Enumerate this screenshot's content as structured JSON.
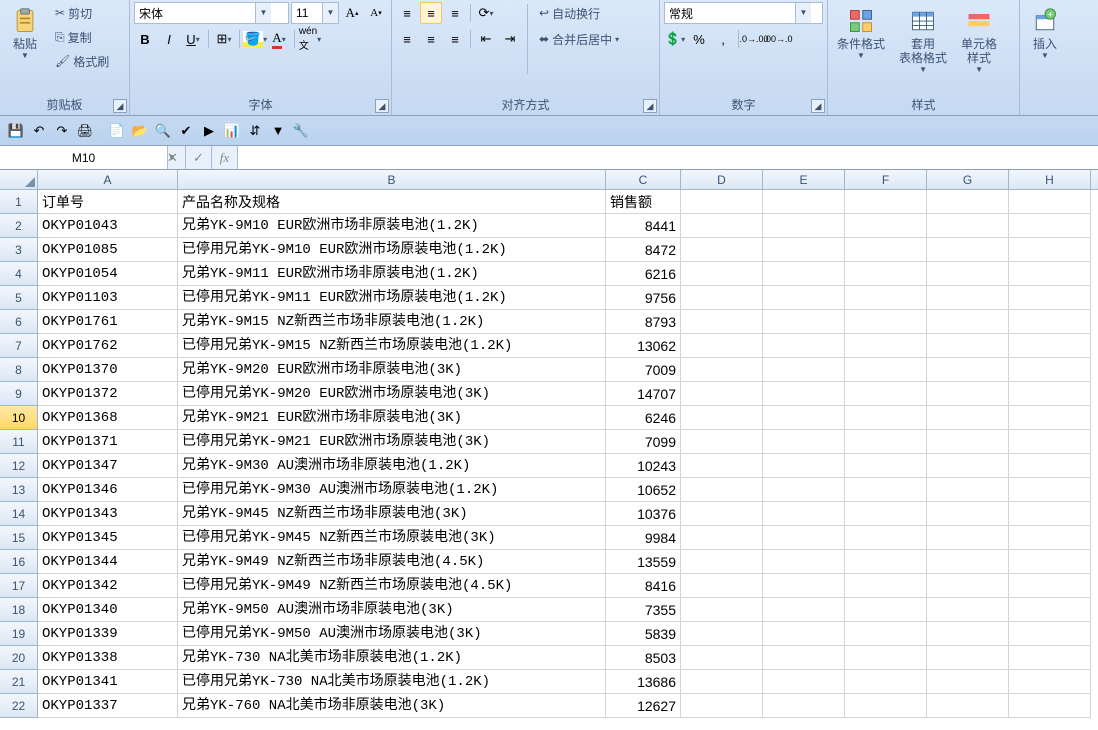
{
  "ribbon": {
    "clipboard": {
      "paste": "粘贴",
      "cut": "剪切",
      "copy": "复制",
      "format_painter": "格式刷",
      "label": "剪贴板"
    },
    "font": {
      "name": "宋体",
      "size": "11",
      "label": "字体"
    },
    "alignment": {
      "wrap": "自动换行",
      "merge": "合并后居中",
      "label": "对齐方式"
    },
    "number": {
      "format": "常规",
      "label": "数字"
    },
    "styles": {
      "conditional": "条件格式",
      "table": "套用\n表格格式",
      "cell": "单元格\n样式",
      "label": "样式"
    },
    "cells": {
      "insert": "插入"
    }
  },
  "namebox": "M10",
  "columns": [
    "A",
    "B",
    "C",
    "D",
    "E",
    "F",
    "G",
    "H"
  ],
  "header_row": {
    "A": "订单号",
    "B": "产品名称及规格",
    "C": "销售额"
  },
  "rows": [
    {
      "n": 1,
      "A": "订单号",
      "B": "产品名称及规格",
      "C": "销售额",
      "header": true
    },
    {
      "n": 2,
      "A": "OKYP01043",
      "B": "兄弟YK-9M10 EUR欧洲市场非原装电池(1.2K)",
      "C": "8441"
    },
    {
      "n": 3,
      "A": "OKYP01085",
      "B": "已停用兄弟YK-9M10 EUR欧洲市场原装电池(1.2K)",
      "C": "8472"
    },
    {
      "n": 4,
      "A": "OKYP01054",
      "B": "兄弟YK-9M11 EUR欧洲市场非原装电池(1.2K)",
      "C": "6216"
    },
    {
      "n": 5,
      "A": "OKYP01103",
      "B": "已停用兄弟YK-9M11 EUR欧洲市场原装电池(1.2K)",
      "C": "9756"
    },
    {
      "n": 6,
      "A": "OKYP01761",
      "B": "兄弟YK-9M15 NZ新西兰市场非原装电池(1.2K)",
      "C": "8793"
    },
    {
      "n": 7,
      "A": "OKYP01762",
      "B": "已停用兄弟YK-9M15 NZ新西兰市场原装电池(1.2K)",
      "C": "13062"
    },
    {
      "n": 8,
      "A": "OKYP01370",
      "B": "兄弟YK-9M20 EUR欧洲市场非原装电池(3K)",
      "C": "7009"
    },
    {
      "n": 9,
      "A": "OKYP01372",
      "B": "已停用兄弟YK-9M20 EUR欧洲市场原装电池(3K)",
      "C": "14707"
    },
    {
      "n": 10,
      "A": "OKYP01368",
      "B": "兄弟YK-9M21 EUR欧洲市场非原装电池(3K)",
      "C": "6246"
    },
    {
      "n": 11,
      "A": "OKYP01371",
      "B": "已停用兄弟YK-9M21 EUR欧洲市场原装电池(3K)",
      "C": "7099"
    },
    {
      "n": 12,
      "A": "OKYP01347",
      "B": "兄弟YK-9M30 AU澳洲市场非原装电池(1.2K)",
      "C": "10243"
    },
    {
      "n": 13,
      "A": "OKYP01346",
      "B": "已停用兄弟YK-9M30 AU澳洲市场原装电池(1.2K)",
      "C": "10652"
    },
    {
      "n": 14,
      "A": "OKYP01343",
      "B": "兄弟YK-9M45 NZ新西兰市场非原装电池(3K)",
      "C": "10376"
    },
    {
      "n": 15,
      "A": "OKYP01345",
      "B": "已停用兄弟YK-9M45 NZ新西兰市场原装电池(3K)",
      "C": "9984"
    },
    {
      "n": 16,
      "A": "OKYP01344",
      "B": "兄弟YK-9M49 NZ新西兰市场非原装电池(4.5K)",
      "C": "13559"
    },
    {
      "n": 17,
      "A": "OKYP01342",
      "B": "已停用兄弟YK-9M49 NZ新西兰市场原装电池(4.5K)",
      "C": "8416"
    },
    {
      "n": 18,
      "A": "OKYP01340",
      "B": "兄弟YK-9M50 AU澳洲市场非原装电池(3K)",
      "C": "7355"
    },
    {
      "n": 19,
      "A": "OKYP01339",
      "B": "已停用兄弟YK-9M50 AU澳洲市场原装电池(3K)",
      "C": "5839"
    },
    {
      "n": 20,
      "A": "OKYP01338",
      "B": "兄弟YK-730 NA北美市场非原装电池(1.2K)",
      "C": "8503"
    },
    {
      "n": 21,
      "A": "OKYP01341",
      "B": "已停用兄弟YK-730 NA北美市场原装电池(1.2K)",
      "C": "13686"
    },
    {
      "n": 22,
      "A": "OKYP01337",
      "B": "兄弟YK-760 NA北美市场非原装电池(3K)",
      "C": "12627"
    }
  ],
  "active_row": 10
}
